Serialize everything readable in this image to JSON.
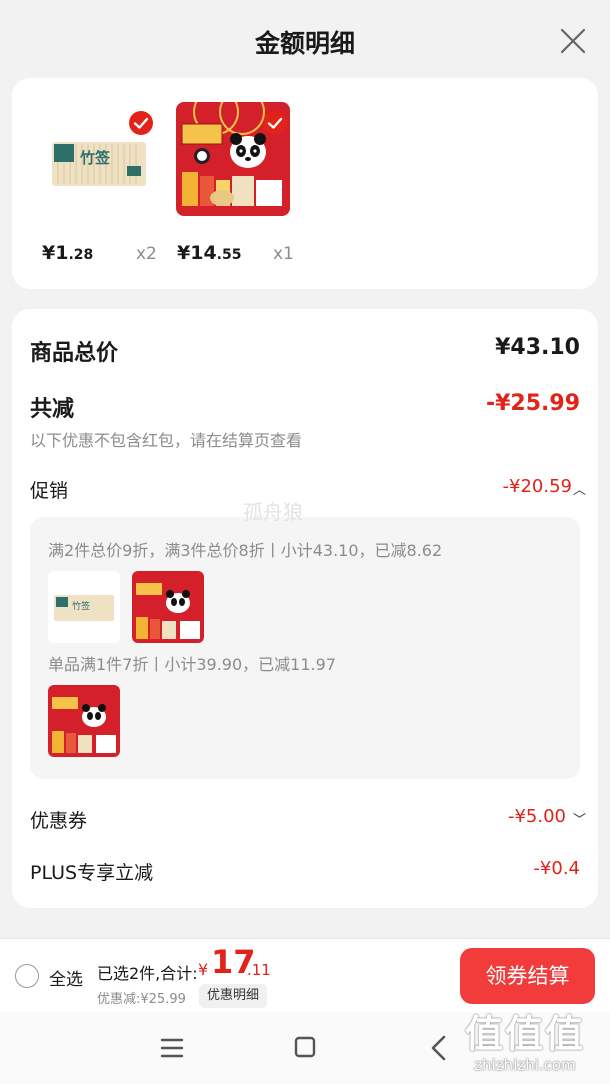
{
  "header": {
    "title": "金额明细",
    "close_icon": "close-icon"
  },
  "products": [
    {
      "name_on_pack": "竹签",
      "price_int": "¥1",
      "price_dec": ".28",
      "qty": "x2",
      "selected": true
    },
    {
      "price_int": "¥14",
      "price_dec": ".55",
      "qty": "x1",
      "selected": true
    }
  ],
  "summary": {
    "total_label": "商品总价",
    "total_value": "¥43.10",
    "discount_label": "共减",
    "discount_value": "-¥25.99",
    "discount_note": "以下优惠不包含红包，请在结算页查看",
    "promo_label": "促销",
    "promo_value": "-¥20.59",
    "promo_chevron": "︿",
    "promo_rule_1": "满2件总价9折，满3件总价8折丨小计43.10，已减8.62",
    "promo_rule_2": "单品满1件7折丨小计39.90，已减11.97",
    "coupon_label": "优惠券",
    "coupon_value": "-¥5.00",
    "coupon_chevron": "﹀",
    "plus_label": "PLUS专享立减",
    "plus_value": "-¥0.4"
  },
  "watermark": "孤舟狼",
  "bottom_bar": {
    "select_all": "全选",
    "selected_text": "已选2件,合计:",
    "total_prefix": "¥",
    "total_int": "17",
    "total_dec": ".11",
    "saved_text": "优惠减:¥25.99",
    "detail_chip": "优惠明细",
    "checkout_button": "领券结算"
  },
  "site_watermark": {
    "big": "值值值",
    "small": "zhizhizhi.com"
  },
  "colors": {
    "accent_red": "#e2231a",
    "button_red": "#f23b3b"
  }
}
